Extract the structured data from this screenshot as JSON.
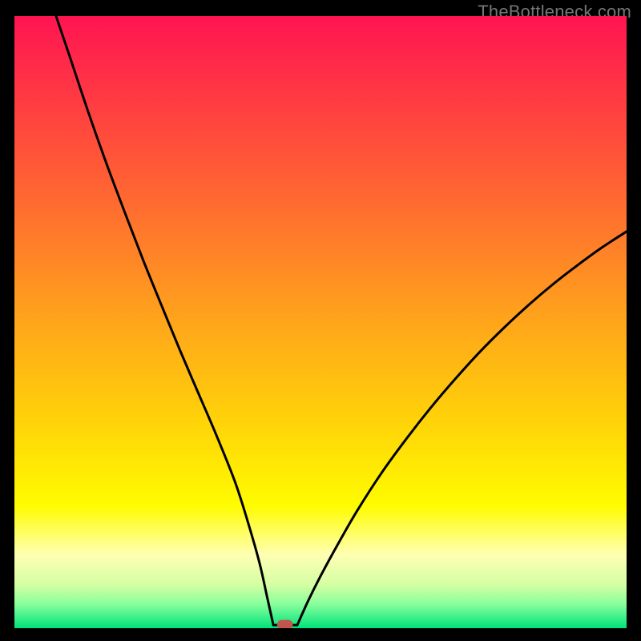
{
  "watermark": "TheBottleneck.com",
  "chart_data": {
    "type": "line",
    "title": "",
    "xlabel": "",
    "ylabel": "",
    "xlim": [
      0,
      100
    ],
    "ylim": [
      0,
      100
    ],
    "grid": false,
    "legend": false,
    "background_gradient": {
      "stops": [
        {
          "offset": 0.0,
          "color": "#ff1452"
        },
        {
          "offset": 0.13,
          "color": "#ff3943"
        },
        {
          "offset": 0.27,
          "color": "#ff6034"
        },
        {
          "offset": 0.4,
          "color": "#ff8726"
        },
        {
          "offset": 0.53,
          "color": "#ffae17"
        },
        {
          "offset": 0.67,
          "color": "#ffd508"
        },
        {
          "offset": 0.8,
          "color": "#fffc00"
        },
        {
          "offset": 0.88,
          "color": "#ffffb3"
        },
        {
          "offset": 0.93,
          "color": "#d3ffa3"
        },
        {
          "offset": 0.96,
          "color": "#8aff9d"
        },
        {
          "offset": 1.0,
          "color": "#00e37a"
        }
      ]
    },
    "series": [
      {
        "name": "left-curve",
        "x": [
          6.8,
          9,
          12,
          15,
          18,
          21,
          24,
          27,
          30,
          33,
          36,
          38,
          40,
          41.3,
          42.3
        ],
        "y": [
          100,
          93.5,
          84.5,
          76,
          68,
          60.2,
          52.8,
          45.5,
          38.5,
          31.5,
          24.0,
          17.8,
          10.8,
          5.0,
          0.5
        ]
      },
      {
        "name": "trough-flat",
        "x": [
          42.3,
          46.2
        ],
        "y": [
          0.5,
          0.5
        ]
      },
      {
        "name": "right-curve",
        "x": [
          46.2,
          48,
          50,
          53,
          56,
          60,
          64,
          68,
          72,
          76,
          80,
          84,
          88,
          92,
          96,
          100
        ],
        "y": [
          0.5,
          4.5,
          8.5,
          14.0,
          19.2,
          25.4,
          30.9,
          36.0,
          40.7,
          45.1,
          49.1,
          52.8,
          56.2,
          59.3,
          62.2,
          64.8
        ]
      }
    ],
    "marker": {
      "name": "trough-marker",
      "shape": "rounded-rect",
      "x": 44.2,
      "y": 0.6,
      "width_pct": 2.6,
      "height_pct": 1.5,
      "color": "#c1564e"
    }
  }
}
